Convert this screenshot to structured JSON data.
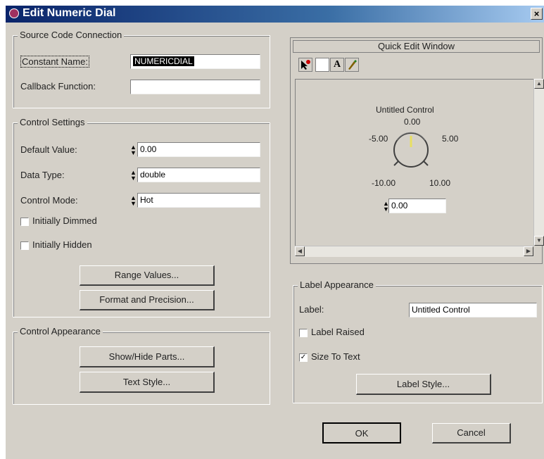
{
  "window": {
    "title": "Edit Numeric Dial",
    "close_glyph": "×"
  },
  "source_code": {
    "legend": "Source Code Connection",
    "constant_name_label": "Constant Name:",
    "constant_name_value": "NUMERICDIAL",
    "callback_label": "Callback Function:",
    "callback_value": ""
  },
  "control_settings": {
    "legend": "Control Settings",
    "default_value_label": "Default Value:",
    "default_value": "0.00",
    "data_type_label": "Data Type:",
    "data_type": "double",
    "control_mode_label": "Control Mode:",
    "control_mode": "Hot",
    "initially_dimmed_label": "Initially Dimmed",
    "initially_dimmed_checked": false,
    "initially_hidden_label": "Initially Hidden",
    "initially_hidden_checked": false,
    "range_values_button": "Range Values...",
    "format_precision_button": "Format and Precision..."
  },
  "control_appearance": {
    "legend": "Control Appearance",
    "show_hide_button": "Show/Hide Parts...",
    "text_style_button": "Text Style..."
  },
  "quick_edit": {
    "title": "Quick Edit Window",
    "tools": [
      "pointer-icon",
      "frame-icon",
      "text-tool-icon",
      "color-brush-icon"
    ],
    "tool_text_glyph": "A",
    "dial": {
      "label": "Untitled Control",
      "tick_top": "0.00",
      "tick_upper_left": "-5.00",
      "tick_upper_right": "5.00",
      "tick_lower_left": "-10.00",
      "tick_lower_right": "10.00",
      "digital_value": "0.00"
    }
  },
  "label_appearance": {
    "legend": "Label Appearance",
    "label_label": "Label:",
    "label_value": "Untitled Control",
    "label_raised_label": "Label Raised",
    "label_raised_checked": false,
    "size_to_text_label": "Size To Text",
    "size_to_text_checked": true,
    "label_style_button": "Label Style..."
  },
  "buttons": {
    "ok": "OK",
    "cancel": "Cancel"
  },
  "glyphs": {
    "check": "✓",
    "scroll_up": "▲",
    "scroll_down": "▼",
    "scroll_left": "◀",
    "scroll_right": "▶",
    "spin": "▲▼"
  }
}
